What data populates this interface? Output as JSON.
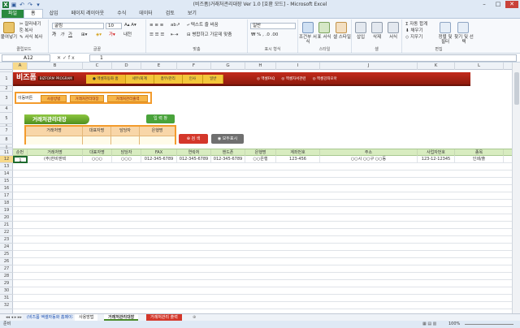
{
  "window": {
    "title": "(비즈폼)거래처관리대장 Ver 1.0 [호환 모드] - Microsoft Excel"
  },
  "ribbon_tabs": [
    "파일",
    "홈",
    "삽입",
    "페이지 레이아웃",
    "수식",
    "데이터",
    "검토",
    "보기"
  ],
  "ribbon": {
    "clipboard": {
      "paste": "붙여넣기",
      "cut": "잘라내기",
      "copy": "복사",
      "format_painter": "서식 복사",
      "label": "클립보드"
    },
    "font": {
      "name": "굴림",
      "size": "10",
      "label": "글꼴"
    },
    "align": {
      "wrap": "텍스트 줄 바꿈",
      "merge": "병합하고 가운데 맞춤",
      "label": "맞춤"
    },
    "number": {
      "format": "일반",
      "label": "표시 형식"
    },
    "styles": {
      "conditional": "조건부 서식",
      "table": "표 서식",
      "cell": "셀 스타일",
      "label": "스타일"
    },
    "cells": {
      "insert": "삽입",
      "delete": "삭제",
      "format": "서식",
      "label": "셀"
    },
    "edit": {
      "autosum": "자동 합계",
      "fill": "채우기",
      "clear": "지우기",
      "sort": "정렬 및 필터",
      "find": "찾기 및 선택",
      "label": "편집"
    }
  },
  "formula_bar": {
    "name_box": "A12",
    "value": "1"
  },
  "columns": [
    "A",
    "B",
    "C",
    "D",
    "E",
    "F",
    "G",
    "H",
    "I",
    "J",
    "K",
    "L"
  ],
  "rows": [
    "1",
    "2",
    "3",
    "4",
    "5",
    "6",
    "7",
    "8",
    "9",
    "10",
    "11",
    "12",
    "13",
    "14",
    "15",
    "16",
    "17",
    "18",
    "19",
    "20",
    "21",
    "22",
    "23",
    "24",
    "25",
    "26",
    "27",
    "28",
    "29",
    "30",
    "31",
    "32"
  ],
  "banner": {
    "logo": "비즈폼",
    "logo_sub": "BIZFORM PROGRAM",
    "nav": [
      "● 엑셀자동화 홈",
      "세무/회계",
      "총무/관리",
      "인사",
      "일반"
    ],
    "links": [
      "◎ 엑셀FAQ",
      "◎ 엑셀자서관련",
      "◎ 엑셀강좌모아"
    ]
  },
  "quick": {
    "label": "이동버튼",
    "buttons": [
      "사용방법",
      "거래처관리대장",
      "거래처관리출력"
    ]
  },
  "page_title": "거래처관리대장",
  "register_button": "입 력 창",
  "search": {
    "headers": [
      "거래처명",
      "대표자명",
      "담당자",
      "은행명"
    ],
    "search_button": "검 색",
    "show_all_button": "모두표시"
  },
  "table": {
    "headers": [
      "순번",
      "거래처명",
      "대표자명",
      "담당자",
      "FAX",
      "연락처",
      "핸드폰",
      "은행명",
      "계좌번호",
      "주소",
      "사업자번호",
      "종목"
    ],
    "rows": [
      [
        "1",
        "(주)한비엔텍",
        "○○○",
        "○○○",
        "012-345-6789",
        "012-345-6789",
        "012-345-6789",
        "○○은행",
        "123-456",
        "○○시 ○○구 ○○동",
        "123-12-12345",
        "인쇄/출"
      ]
    ]
  },
  "sheets": [
    "(비즈폼 엑셀자동화 홈페이지)",
    "사용방법",
    "거래처관리대장",
    "거래처관리 출력"
  ],
  "status": {
    "left": "준비",
    "zoom": "100%"
  },
  "colors": {
    "banner": "#c32a1a",
    "nav": "#f3c73b",
    "accent_orange": "#f39b2c",
    "header_green": "#d8ecc0",
    "title_green": "#6aa82e"
  }
}
